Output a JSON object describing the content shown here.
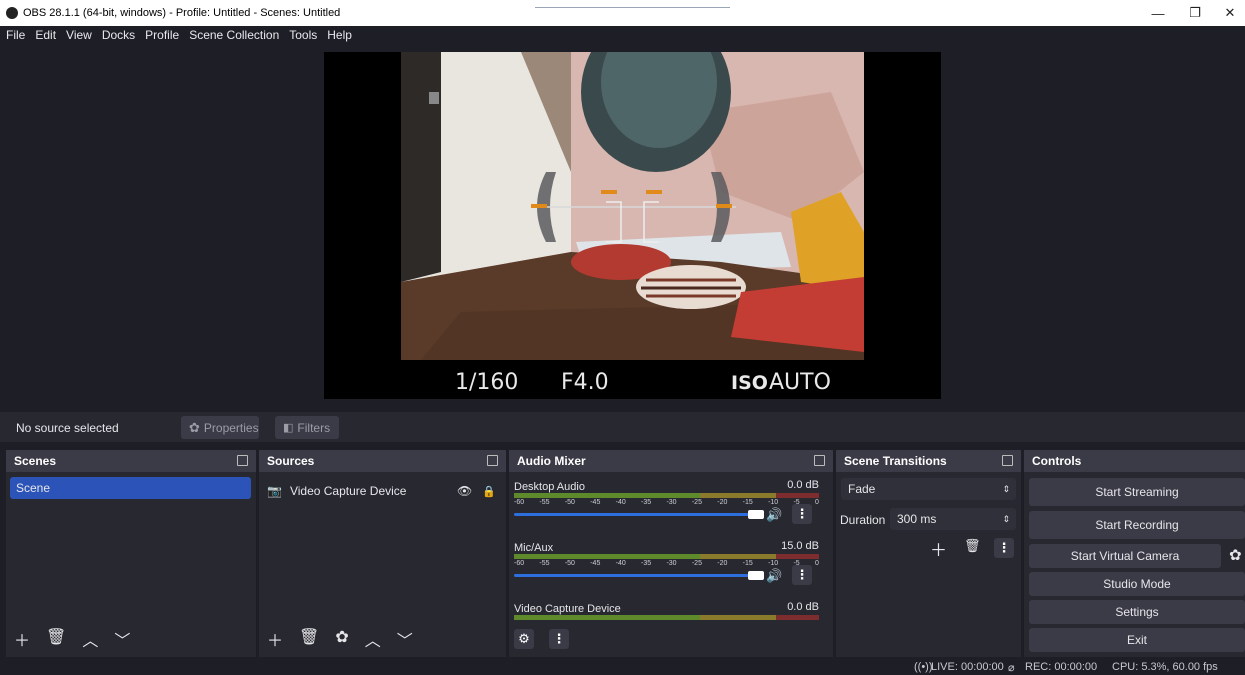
{
  "window": {
    "title": "OBS 28.1.1 (64-bit, windows) - Profile: Untitled - Scenes: Untitled",
    "minimize": "—",
    "maximize": "❐",
    "close": "✕"
  },
  "menu": [
    "File",
    "Edit",
    "View",
    "Docks",
    "Profile",
    "Scene Collection",
    "Tools",
    "Help"
  ],
  "preview": {
    "shutter": "1/160",
    "aperture": "F4.0",
    "iso_label": "ISO",
    "iso_value": "AUTO"
  },
  "source_toolbar": {
    "no_source": "No source selected",
    "properties": "Properties",
    "filters": "Filters"
  },
  "scenes": {
    "title": "Scenes",
    "items": [
      "Scene"
    ]
  },
  "sources": {
    "title": "Sources",
    "items": [
      "Video Capture Device"
    ]
  },
  "mixer": {
    "title": "Audio Mixer",
    "scale": [
      "-60",
      "-55",
      "-50",
      "-45",
      "-40",
      "-35",
      "-30",
      "-25",
      "-20",
      "-15",
      "-10",
      "-5",
      "0"
    ],
    "channels": [
      {
        "name": "Desktop Audio",
        "db": "0.0 dB"
      },
      {
        "name": "Mic/Aux",
        "db": "15.0 dB"
      },
      {
        "name": "Video Capture Device",
        "db": "0.0 dB"
      }
    ]
  },
  "transitions": {
    "title": "Scene Transitions",
    "selected": "Fade",
    "duration_label": "Duration",
    "duration_value": "300 ms"
  },
  "controls": {
    "title": "Controls",
    "start_streaming": "Start Streaming",
    "start_recording": "Start Recording",
    "start_virtual_camera": "Start Virtual Camera",
    "studio_mode": "Studio Mode",
    "settings": "Settings",
    "exit": "Exit"
  },
  "status": {
    "live": "LIVE: 00:00:00",
    "rec": "REC: 00:00:00",
    "cpu": "CPU: 5.3%, 60.00 fps"
  },
  "colors": {
    "accent": "#2c54b8",
    "panel": "#272830",
    "background": "#1e1f26"
  }
}
